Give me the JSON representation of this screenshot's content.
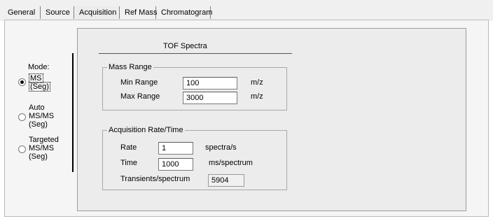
{
  "tabs": [
    "General",
    "Source",
    "Acquisition",
    "Ref Mass",
    "Chromatogram"
  ],
  "active_tab": "Acquisition",
  "mode": {
    "label": "Mode:",
    "options": [
      {
        "line1": "MS",
        "line2": "(Seg)",
        "line3": "",
        "selected": true
      },
      {
        "line1": "Auto",
        "line2": "MS/MS",
        "line3": "(Seg)",
        "selected": false
      },
      {
        "line1": "Targeted",
        "line2": "MS/MS",
        "line3": "(Seg)",
        "selected": false
      }
    ]
  },
  "tof_spectra": {
    "title": "TOF Spectra",
    "mass_range": {
      "legend": "Mass Range",
      "min_label": "Min Range",
      "min_value": "100",
      "max_label": "Max Range",
      "max_value": "3000",
      "unit": "m/z"
    },
    "acquisition": {
      "legend": "Acquisition Rate/Time",
      "rate_label": "Rate",
      "rate_value": "1",
      "rate_unit": "spectra/s",
      "time_label": "Time",
      "time_value": "1000",
      "time_unit": "ms/spectrum",
      "transients_label": "Transients/spectrum",
      "transients_value": "5904"
    }
  },
  "colors": {
    "background": "#f0f0f0",
    "panel": "#ececec",
    "field": "#ffffff"
  }
}
